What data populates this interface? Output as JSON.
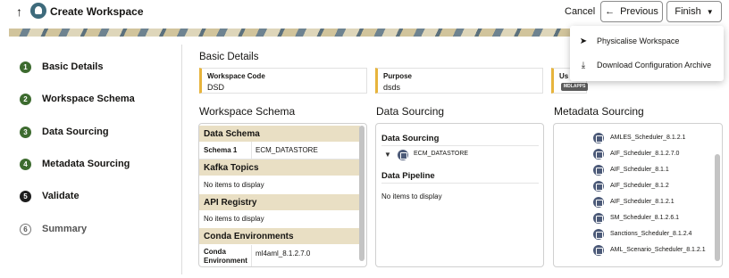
{
  "header": {
    "title": "Create Workspace",
    "cancel_label": "Cancel",
    "previous_label": "Previous",
    "finish_label": "Finish"
  },
  "finish_menu": {
    "items": [
      {
        "label": "Physicalise Workspace",
        "icon": "send-icon"
      },
      {
        "label": "Download Configuration Archive",
        "icon": "download-icon"
      }
    ]
  },
  "steps": [
    {
      "number": "1",
      "label": "Basic Details",
      "state": "done"
    },
    {
      "number": "2",
      "label": "Workspace Schema",
      "state": "done"
    },
    {
      "number": "3",
      "label": "Data Sourcing",
      "state": "done"
    },
    {
      "number": "4",
      "label": "Metadata Sourcing",
      "state": "done"
    },
    {
      "number": "5",
      "label": "Validate",
      "state": "current"
    },
    {
      "number": "6",
      "label": "Summary",
      "state": "pending"
    }
  ],
  "basic_details": {
    "title": "Basic Details",
    "workspace_code_label": "Workspace Code",
    "workspace_code_value": "DSD",
    "purpose_label": "Purpose",
    "purpose_value": "dsds",
    "third_label": "Us",
    "badge": "MDLAPPS"
  },
  "workspace_schema": {
    "title": "Workspace Schema",
    "data_schema_title": "Data Schema",
    "schema_row": {
      "key": "Schema 1",
      "value": "ECM_DATASTORE"
    },
    "kafka_title": "Kafka Topics",
    "kafka_empty": "No items to display",
    "api_title": "API Registry",
    "api_empty": "No items to display",
    "conda_title": "Conda Environments",
    "conda_row": {
      "key": "Conda Environment",
      "value": "ml4aml_8.1.2.7.0"
    }
  },
  "data_sourcing": {
    "title": "Data Sourcing",
    "section_label": "Data Sourcing",
    "item": "ECM_DATASTORE",
    "pipeline_label": "Data Pipeline",
    "pipeline_empty": "No items to display"
  },
  "metadata_sourcing": {
    "title": "Metadata Sourcing",
    "items": [
      "AMLES_Scheduler_8.1.2.1",
      "AIF_Scheduler_8.1.2.7.0",
      "AIF_Scheduler_8.1.1",
      "AIF_Scheduler_8.1.2",
      "AIF_Scheduler_8.1.2.1",
      "SM_Scheduler_8.1.2.6.1",
      "Sanctions_Scheduler_8.1.2.4",
      "AML_Scenario_Scheduler_8.1.2.1"
    ]
  },
  "colors": {
    "step_done": "#3d6b2f",
    "card_accent": "#e7b43c",
    "schema_header": "#e9dfc4"
  }
}
